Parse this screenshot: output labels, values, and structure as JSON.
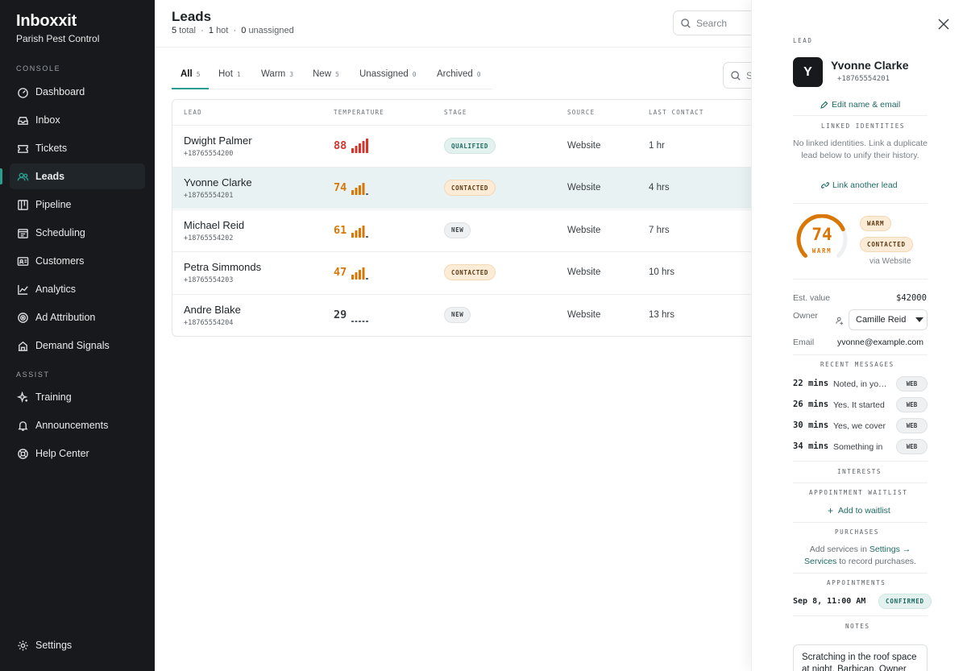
{
  "app": {
    "brand": "Inboxxit",
    "org": "Parish Pest Control"
  },
  "sidebar": {
    "console_label": "CONSOLE",
    "assist_label": "ASSIST",
    "console_items": [
      {
        "label": "Dashboard",
        "icon": "dashboard-icon"
      },
      {
        "label": "Inbox",
        "icon": "inbox-icon"
      },
      {
        "label": "Tickets",
        "icon": "ticket-icon"
      },
      {
        "label": "Leads",
        "icon": "users-icon",
        "active": true
      },
      {
        "label": "Pipeline",
        "icon": "pipeline-icon"
      },
      {
        "label": "Scheduling",
        "icon": "calendar-icon"
      },
      {
        "label": "Customers",
        "icon": "id-card-icon"
      },
      {
        "label": "Analytics",
        "icon": "chart-line-icon"
      },
      {
        "label": "Ad Attribution",
        "icon": "target-icon"
      },
      {
        "label": "Demand Signals",
        "icon": "building-icon"
      }
    ],
    "assist_items": [
      {
        "label": "Training",
        "icon": "sparkle-icon"
      },
      {
        "label": "Announcements",
        "icon": "bell-icon"
      },
      {
        "label": "Help Center",
        "icon": "lifebuoy-icon"
      }
    ],
    "settings_label": "Settings"
  },
  "header": {
    "title": "Leads",
    "total": "5",
    "total_label": "total",
    "hot": "1",
    "hot_label": "hot",
    "unassigned": "0",
    "unassigned_label": "unassigned",
    "search_placeholder": "Search",
    "search2_placeholder": "S"
  },
  "tabs": [
    {
      "label": "All",
      "count": "5",
      "active": true
    },
    {
      "label": "Hot",
      "count": "1"
    },
    {
      "label": "Warm",
      "count": "3"
    },
    {
      "label": "New",
      "count": "5"
    },
    {
      "label": "Unassigned",
      "count": "0"
    },
    {
      "label": "Archived",
      "count": "0"
    }
  ],
  "table": {
    "columns": [
      "LEAD",
      "TEMPERATURE",
      "STAGE",
      "SOURCE",
      "LAST CONTACT"
    ],
    "rows": [
      {
        "name": "Dwight Palmer",
        "phone": "+18765554200",
        "temp": "88",
        "temp_level": 5,
        "temp_color": "#d9342b",
        "stage": "QUALIFIED",
        "stage_kind": "q",
        "source": "Website",
        "last": "1 hr"
      },
      {
        "name": "Yvonne Clarke",
        "phone": "+18765554201",
        "temp": "74",
        "temp_level": 4,
        "temp_color": "#d97706",
        "stage": "CONTACTED",
        "stage_kind": "c",
        "source": "Website",
        "last": "4 hrs",
        "selected": true
      },
      {
        "name": "Michael Reid",
        "phone": "+18765554202",
        "temp": "61",
        "temp_level": 4,
        "temp_color": "#d97706",
        "stage": "NEW",
        "stage_kind": "n",
        "source": "Website",
        "last": "7 hrs"
      },
      {
        "name": "Petra Simmonds",
        "phone": "+18765554203",
        "temp": "47",
        "temp_level": 4,
        "temp_color": "#d97706",
        "stage": "CONTACTED",
        "stage_kind": "c",
        "source": "Website",
        "last": "10 hrs"
      },
      {
        "name": "Andre Blake",
        "phone": "+18765554204",
        "temp": "29",
        "temp_level": 0,
        "temp_color": "#3a3f44",
        "stage": "NEW",
        "stage_kind": "n",
        "source": "Website",
        "last": "13 hrs"
      }
    ]
  },
  "panel": {
    "section_label": "LEAD",
    "avatar": "Y",
    "name": "Yvonne Clarke",
    "phone": "+18765554201",
    "edit_link": "Edit name & email",
    "linked_label": "LINKED IDENTITIES",
    "linked_text": "No linked identities. Link a duplicate lead below to unify their history.",
    "link_another": "Link another lead",
    "score": "74",
    "score_fraction": 0.74,
    "score_word": "WARM",
    "temp_pill": "WARM",
    "stage_pill": "CONTACTED",
    "via": "via Website",
    "est_value_label": "Est. value",
    "est_value": "$42000",
    "owner_label": "Owner",
    "owner": "Camille Reid",
    "email_label": "Email",
    "email": "yvonne@example.com",
    "recent_label": "RECENT MESSAGES",
    "messages": [
      {
        "time": "22 mins",
        "text": "Noted, in your area",
        "channel": "WEB"
      },
      {
        "time": "26 mins",
        "text": "Yes. It started",
        "channel": "WEB"
      },
      {
        "time": "30 mins",
        "text": "Yes, we cover",
        "channel": "WEB"
      },
      {
        "time": "34 mins",
        "text": "Something in",
        "channel": "WEB"
      }
    ],
    "interests_label": "INTERESTS",
    "waitlist_label": "APPOINTMENT WAITLIST",
    "add_waitlist": "Add to waitlist",
    "purchases_label": "PURCHASES",
    "purchases_pre": "Add services in",
    "purchases_link": "Settings → Services",
    "purchases_post": "to record purchases.",
    "appointments_label": "APPOINTMENTS",
    "appointment_time": "Sep 8, 11:00 AM",
    "appointment_status": "CONFIRMED",
    "notes_label": "NOTES",
    "note": "Scratching in the roof space at night. Barbican. Owner"
  },
  "colors": {
    "accent": "#2a9d8f",
    "sidebar": "#17191c",
    "warm": "#d97706",
    "hot": "#d9342b"
  }
}
